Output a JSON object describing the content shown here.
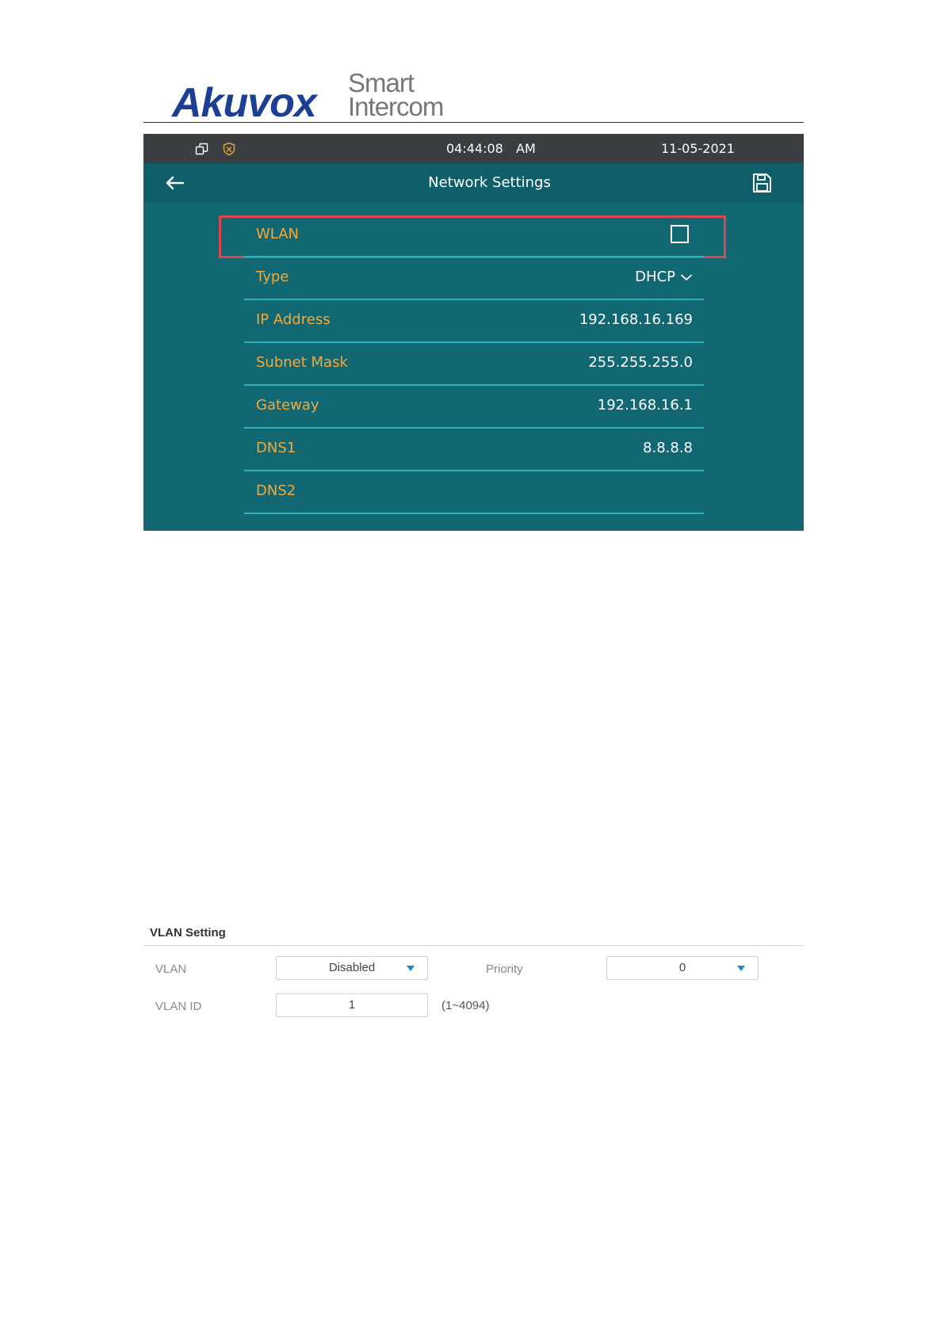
{
  "logo": {
    "brand": "Akuvox",
    "tagline_line1": "Smart",
    "tagline_line2": "Intercom"
  },
  "device": {
    "statusbar": {
      "time": "04:44:08",
      "ampm": "AM",
      "date": "11-05-2021",
      "icons": [
        "windows-icon",
        "shield-icon"
      ]
    },
    "titlebar": {
      "title": "Network Settings",
      "back_icon": "arrow-left-icon",
      "save_icon": "save-icon"
    },
    "rows": {
      "wlan": {
        "label": "WLAN",
        "checked": false
      },
      "type": {
        "label": "Type",
        "value": "DHCP"
      },
      "ip": {
        "label": "IP Address",
        "value": "192.168.16.169"
      },
      "subnet": {
        "label": "Subnet Mask",
        "value": "255.255.255.0"
      },
      "gateway": {
        "label": "Gateway",
        "value": "192.168.16.1"
      },
      "dns1": {
        "label": "DNS1",
        "value": "8.8.8.8"
      },
      "dns2": {
        "label": "DNS2",
        "value": ""
      }
    },
    "colors": {
      "screen_bg": "#126872",
      "statusbar_bg": "#3b3e41",
      "label": "#f3a93b",
      "divider": "#2fb1bd",
      "highlight": "#d9474f"
    }
  },
  "vlan": {
    "title": "VLAN Setting",
    "vlan_label": "VLAN",
    "vlan_value": "Disabled",
    "priority_label": "Priority",
    "priority_value": "0",
    "vlan_id_label": "VLAN ID",
    "vlan_id_value": "1",
    "vlan_id_range": "(1~4094)",
    "accent": "#1e88c8"
  }
}
